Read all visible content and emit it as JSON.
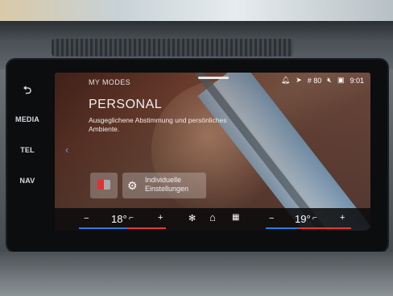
{
  "side": {
    "back_icon": "back-arrow-icon",
    "media": "MEDIA",
    "tel": "TEL",
    "nav": "NAV"
  },
  "screen": {
    "section_title": "MY MODES",
    "mode_title": "PERSONAL",
    "description": "Ausgeglichene Abstimmung und persönliches Ambiente.",
    "option_label_line1": "Individuelle",
    "option_label_line2": "Einstellungen"
  },
  "status": {
    "network": "# 80",
    "time": "9:01"
  },
  "climate": {
    "left_minus": "−",
    "left_temp": "18°",
    "left_plus": "+",
    "right_minus": "−",
    "right_temp": "19°",
    "right_plus": "+"
  },
  "colors": {
    "accent_blue": "#2c7be0",
    "accent_red": "#e03a3a"
  }
}
